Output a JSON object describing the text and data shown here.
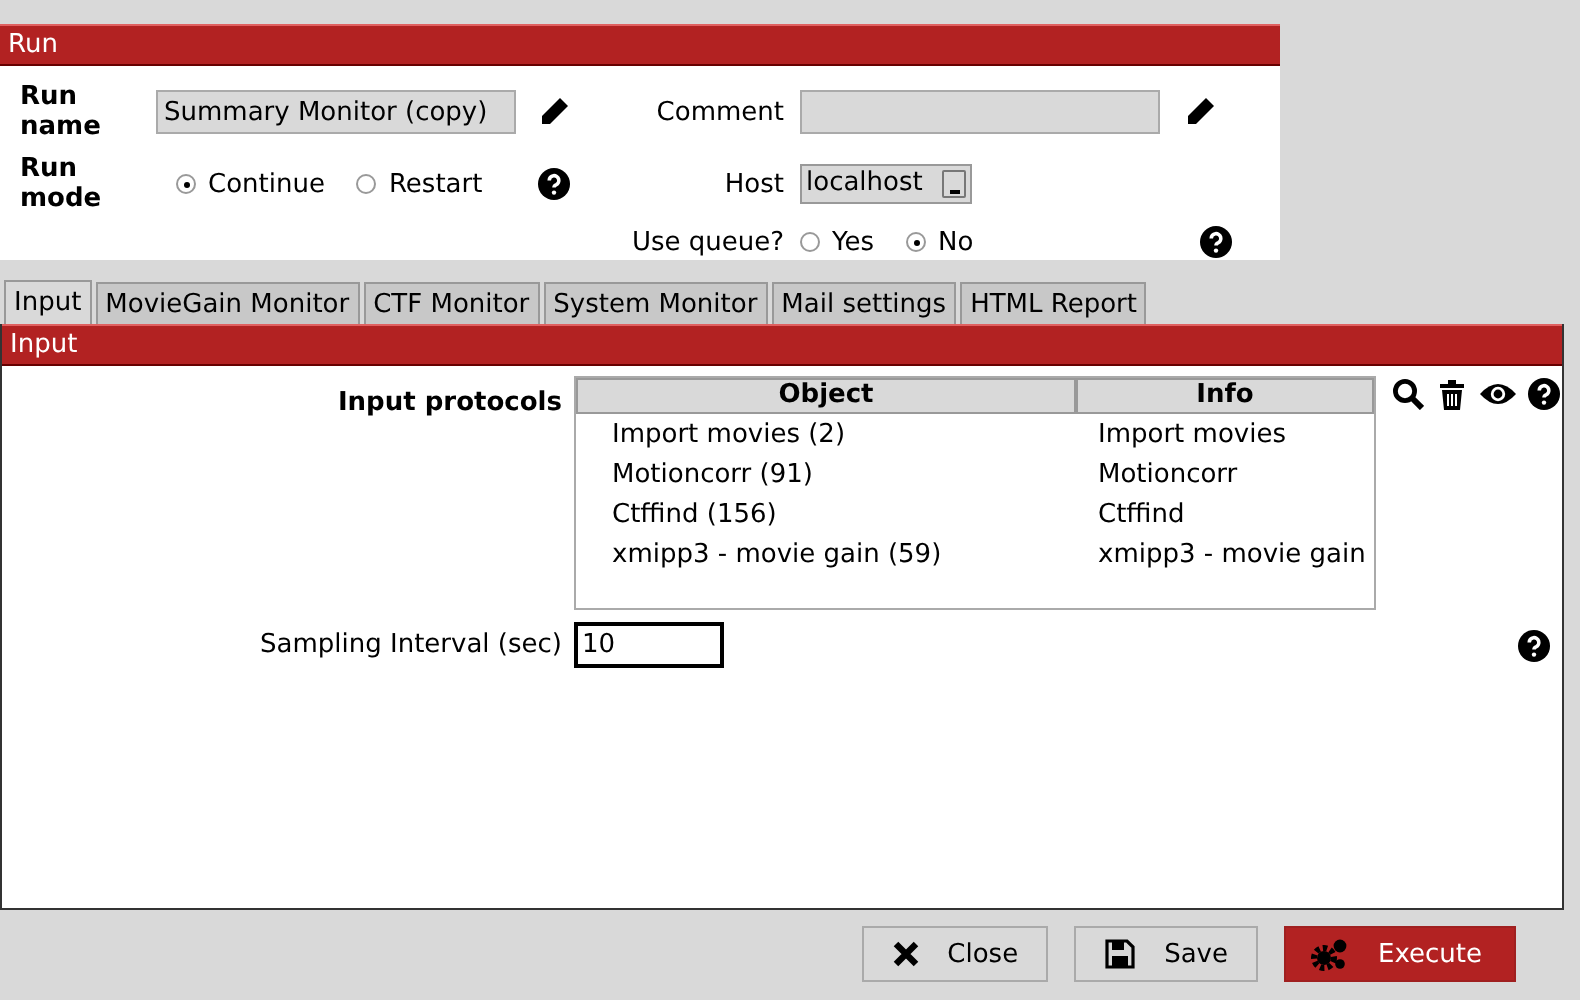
{
  "run_panel": {
    "title": "Run",
    "run_name": {
      "label": "Run name",
      "value": "Summary Monitor (copy)"
    },
    "comment": {
      "label": "Comment"
    },
    "run_mode": {
      "label": "Run mode",
      "options": [
        {
          "label": "Continue",
          "selected": true
        },
        {
          "label": "Restart",
          "selected": false
        }
      ]
    },
    "host": {
      "label": "Host",
      "value": "localhost"
    },
    "use_queue": {
      "label": "Use queue?",
      "options": [
        {
          "label": "Yes",
          "selected": false
        },
        {
          "label": "No",
          "selected": true
        }
      ]
    }
  },
  "tabs": [
    {
      "label": "Input",
      "selected": true
    },
    {
      "label": "MovieGain Monitor",
      "selected": false
    },
    {
      "label": "CTF Monitor",
      "selected": false
    },
    {
      "label": "System Monitor",
      "selected": false
    },
    {
      "label": "Mail settings",
      "selected": false
    },
    {
      "label": "HTML Report",
      "selected": false
    }
  ],
  "input_panel": {
    "title": "Input",
    "input_protocols": {
      "label": "Input protocols",
      "columns": [
        "Object",
        "Info"
      ],
      "rows": [
        [
          "Import movies (2)",
          "Import movies"
        ],
        [
          "Motioncorr (91)",
          "Motioncorr"
        ],
        [
          "Ctffind (156)",
          "Ctffind"
        ],
        [
          "xmipp3 - movie gain (59)",
          "xmipp3 - movie gain"
        ]
      ]
    },
    "sampling_interval": {
      "label": "Sampling Interval (sec)",
      "value": "10"
    }
  },
  "buttons": [
    {
      "label": "Close",
      "kind": "close"
    },
    {
      "label": "Save",
      "kind": "save"
    },
    {
      "label": "Execute",
      "kind": "execute"
    }
  ]
}
